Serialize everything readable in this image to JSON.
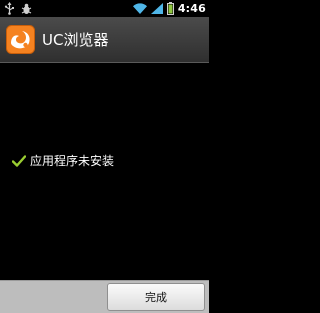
{
  "status_bar": {
    "time": "4:46",
    "icons": [
      "usb-icon",
      "debug-icon",
      "wifi-icon",
      "signal-icon",
      "battery-icon"
    ]
  },
  "title_bar": {
    "title": "UC浏览器",
    "icon": "uc-browser-icon"
  },
  "main": {
    "status_icon": "check-icon",
    "status_text": "应用程序未安装"
  },
  "buttons": {
    "done_label": "完成"
  },
  "colors": {
    "title_bar": "#3a3a3a",
    "check": "#9acd32",
    "app_icon": "#f58220",
    "button_bar": "#bdbdbd"
  }
}
